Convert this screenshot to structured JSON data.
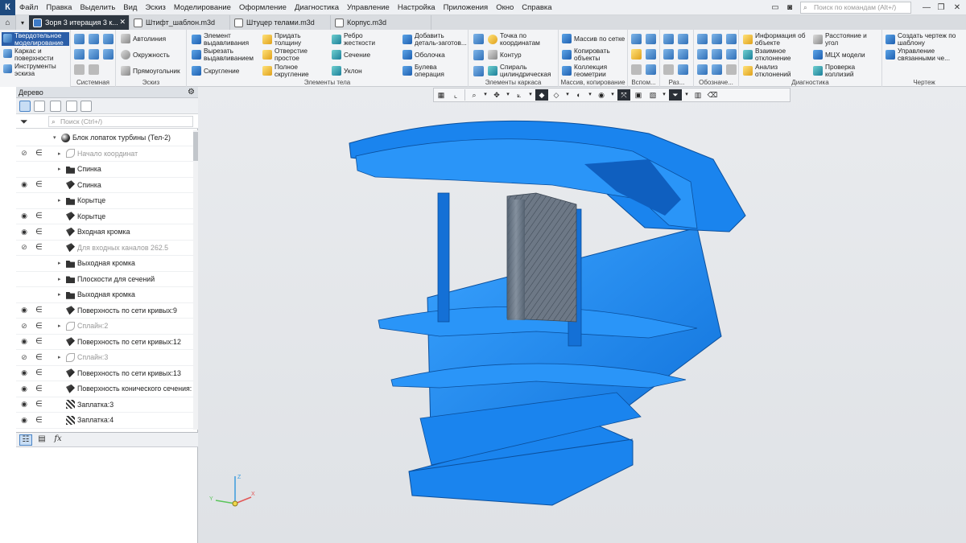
{
  "app": {
    "logo": "К",
    "menu": [
      "Файл",
      "Правка",
      "Выделить",
      "Вид",
      "Эскиз",
      "Моделирование",
      "Оформление",
      "Диагностика",
      "Управление",
      "Настройка",
      "Приложения",
      "Окно",
      "Справка"
    ],
    "command_search_placeholder": "Поиск по командам (Alt+/)"
  },
  "tabs": [
    {
      "label": "Зоря 3 итерация 3 к...",
      "active": true
    },
    {
      "label": "Штифт_шаблон.m3d",
      "active": false
    },
    {
      "label": "Штуцер телами.m3d",
      "active": false
    },
    {
      "label": "Корпус.m3d",
      "active": false
    }
  ],
  "modes": [
    {
      "label": "Твердотельное моделирование",
      "active": true
    },
    {
      "label": "Каркас и поверхности",
      "active": false
    },
    {
      "label": "Инструменты эскиза",
      "active": false
    }
  ],
  "ribbon": {
    "sketch": {
      "buttons": [
        "Автолиния",
        "Окружность",
        "Прямоугольник"
      ]
    },
    "solid_col1": [
      "Элемент выдавливания",
      "Вырезать выдавливанием",
      "Скругление"
    ],
    "solid_col2": [
      "Придать толщину",
      "Отверстие простое",
      "Полное скругление"
    ],
    "solid_col3": [
      "Ребро жесткости",
      "Сечение",
      "Уклон"
    ],
    "solid_col4": [
      "Добавить деталь-заготов...",
      "Оболочка",
      "Булева операция"
    ],
    "frame": [
      "Точка по координатам",
      "Контур",
      "Спираль цилиндрическая"
    ],
    "array": [
      "Массив по сетке",
      "Копировать объекты",
      "Коллекция геометрии"
    ],
    "diag_col1": [
      "Информация об объекте",
      "Взаимное отклонение",
      "Анализ отклонений"
    ],
    "diag_col2": [
      "Расстояние и угол",
      "МЦХ модели",
      "Проверка коллизий"
    ],
    "drawing": [
      "Создать чертеж по шаблону",
      "Управление связанными че..."
    ],
    "group_labels": {
      "system": "Системная",
      "sketch": "Эскиз",
      "solid": "Элементы тела",
      "frame": "Элементы каркаса",
      "array": "Массив, копирование",
      "aux": "Вспом...",
      "size": "Раз...",
      "notation": "Обозначе...",
      "diagnostics": "Диагностика",
      "drawing": "Чертеж"
    }
  },
  "tree": {
    "header": "Дерево",
    "search_placeholder": "Поиск (Ctrl+/)",
    "items": [
      {
        "label": "Блок лопаток турбины (Тел-2)",
        "icon": "body-icon",
        "eye": "",
        "epsilon": false,
        "arrow": "▾",
        "indent": 0,
        "dim": false
      },
      {
        "label": "Начало координат",
        "icon": "origin-icon",
        "eye": "hidden",
        "epsilon": true,
        "arrow": "▸",
        "indent": 1,
        "dim": true
      },
      {
        "label": "Спинка",
        "icon": "folder-icon",
        "eye": "",
        "epsilon": false,
        "arrow": "▸",
        "indent": 1,
        "dim": false
      },
      {
        "label": "Спинка",
        "icon": "surface-icon",
        "eye": "visible",
        "epsilon": true,
        "arrow": "",
        "indent": 1,
        "dim": false
      },
      {
        "label": "Корытце",
        "icon": "folder-icon",
        "eye": "",
        "epsilon": false,
        "arrow": "▸",
        "indent": 1,
        "dim": false
      },
      {
        "label": "Корытце",
        "icon": "surface-icon",
        "eye": "visible",
        "epsilon": true,
        "arrow": "",
        "indent": 1,
        "dim": false
      },
      {
        "label": "Входная кромка",
        "icon": "surface-icon",
        "eye": "visible",
        "epsilon": true,
        "arrow": "",
        "indent": 1,
        "dim": false
      },
      {
        "label": "Для входных каналов 262.5",
        "icon": "surface-icon",
        "eye": "hidden",
        "epsilon": true,
        "arrow": "",
        "indent": 1,
        "dim": true
      },
      {
        "label": "Выходная кромка",
        "icon": "folder-icon",
        "eye": "",
        "epsilon": false,
        "arrow": "▸",
        "indent": 1,
        "dim": false
      },
      {
        "label": "Плоскости для сечений",
        "icon": "folder-icon",
        "eye": "",
        "epsilon": false,
        "arrow": "▸",
        "indent": 1,
        "dim": false
      },
      {
        "label": "Выходная кромка",
        "icon": "folder-icon",
        "eye": "",
        "epsilon": false,
        "arrow": "▸",
        "indent": 1,
        "dim": false
      },
      {
        "label": "Поверхность по сети кривых:9",
        "icon": "surface-icon",
        "eye": "visible",
        "epsilon": true,
        "arrow": "",
        "indent": 1,
        "dim": false
      },
      {
        "label": "Сплайн:2",
        "icon": "spline-icon",
        "eye": "hidden",
        "epsilon": true,
        "arrow": "▸",
        "indent": 1,
        "dim": true
      },
      {
        "label": "Поверхность по сети кривых:12",
        "icon": "surface-icon",
        "eye": "visible",
        "epsilon": true,
        "arrow": "",
        "indent": 1,
        "dim": false
      },
      {
        "label": "Сплайн:3",
        "icon": "spline-icon",
        "eye": "hidden",
        "epsilon": true,
        "arrow": "▸",
        "indent": 1,
        "dim": true
      },
      {
        "label": "Поверхность по сети кривых:13",
        "icon": "surface-icon",
        "eye": "visible",
        "epsilon": true,
        "arrow": "",
        "indent": 1,
        "dim": false
      },
      {
        "label": "Поверхность конического сечения:",
        "icon": "surface-icon",
        "eye": "visible",
        "epsilon": true,
        "arrow": "",
        "indent": 1,
        "dim": false
      },
      {
        "label": "Заплатка:3",
        "icon": "patch-icon",
        "eye": "visible",
        "epsilon": true,
        "arrow": "",
        "indent": 1,
        "dim": false
      },
      {
        "label": "Заплатка:4",
        "icon": "patch-icon",
        "eye": "visible",
        "epsilon": true,
        "arrow": "",
        "indent": 1,
        "dim": false
      }
    ]
  },
  "axis_labels": {
    "x": "X",
    "y": "Y",
    "z": "Z"
  },
  "colors": {
    "model": "#1a84ee",
    "model_dark": "#0f5fbf",
    "core": "#6b7a8c",
    "active_tab": "#2d3640",
    "accent": "#2b5ea8"
  }
}
